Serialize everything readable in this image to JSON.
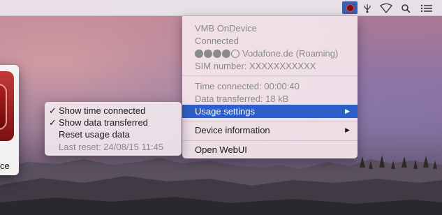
{
  "status_item": {
    "label": "VMB OnDevice",
    "icon": "device-dot-icon",
    "accent": "#3a5fb0"
  },
  "menubar_icons": [
    "usb-connection-icon",
    "wifi-icon",
    "search-icon",
    "list-icon"
  ],
  "app_window": {
    "caption": "ce"
  },
  "main_menu": {
    "title": "VMB OnDevice",
    "status": "Connected",
    "network": "Vodafone.de (Roaming)",
    "signal": {
      "filled": 4,
      "total": 5
    },
    "sim": "SIM number: XXXXXXXXXXX",
    "time_connected": "Time connected: 00:00:40",
    "data_transferred": "Data transferred: 18 kB",
    "items": [
      {
        "label": "Usage settings",
        "submenu": true,
        "highlighted": true
      },
      {
        "label": "Device information",
        "submenu": true
      },
      {
        "label": "Open WebUI",
        "submenu": false
      }
    ],
    "submenu_arrow": "▶"
  },
  "submenu": {
    "items": [
      {
        "check": "✓",
        "label": "Show time connected"
      },
      {
        "check": "✓",
        "label": "Show data transferred"
      },
      {
        "check": "",
        "label": "Reset usage data"
      }
    ],
    "last_reset": "Last reset: 24/08/15 11:45"
  },
  "colors": {
    "highlight": "#2e5ec8",
    "disabled_text": "#8a8a8a"
  }
}
